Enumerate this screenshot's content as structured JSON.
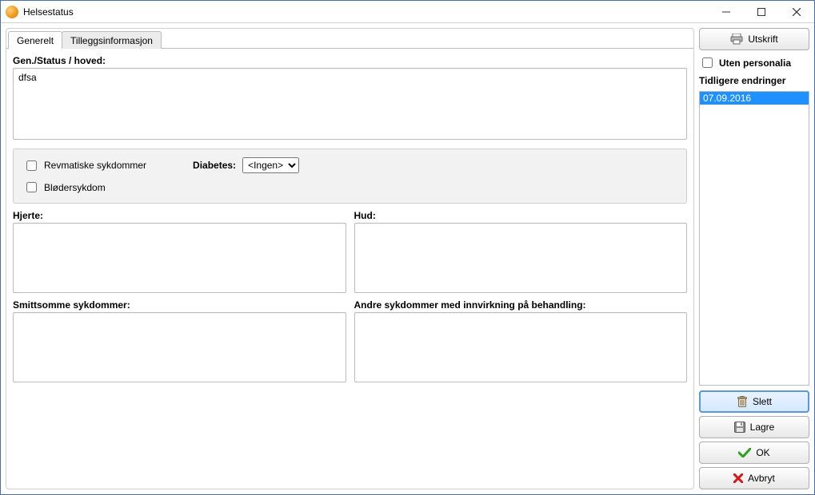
{
  "window": {
    "title": "Helsestatus"
  },
  "tabs": {
    "generelt": "Generelt",
    "tillegg": "Tilleggsinformasjon",
    "active": "generelt"
  },
  "main": {
    "gen_status_label": "Gen./Status / hoved:",
    "gen_status_value": "dfsa",
    "checks": {
      "revmatiske": "Revmatiske sykdommer",
      "bloder": "Blødersykdom"
    },
    "diabetes": {
      "label": "Diabetes:",
      "selected": "<Ingen>"
    },
    "hjerte_label": "Hjerte:",
    "hjerte_value": "",
    "hud_label": "Hud:",
    "hud_value": "",
    "smittsomme_label": "Smittsomme sykdommer:",
    "smittsomme_value": "",
    "andre_label": "Andre sykdommer med innvirkning på behandling:",
    "andre_value": ""
  },
  "side": {
    "utskrift": "Utskrift",
    "uten_personalia": "Uten personalia",
    "history_label": "Tidligere endringer",
    "history_items": [
      "07.09.2016"
    ],
    "slett": "Slett",
    "lagre": "Lagre",
    "ok": "OK",
    "avbryt": "Avbryt"
  }
}
